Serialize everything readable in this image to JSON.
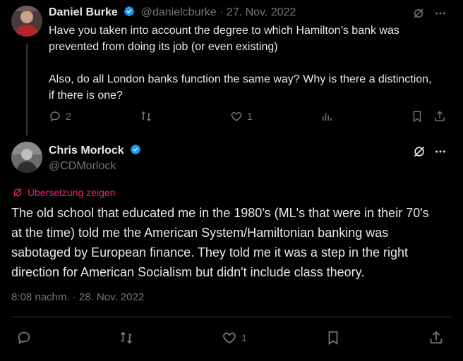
{
  "reply_tweet": {
    "author_name": "Daniel Burke",
    "author_handle": "@danielcburke",
    "date_sep": "·",
    "date": "27. Nov. 2022",
    "text_line1": "Have you taken into account the degree to which Hamilton’s bank was",
    "text_line2": "prevented from doing its job (or even existing)",
    "text_line3": "Also, do all London banks function the same way? Why is there a distinction,",
    "text_line4": "if there is one?",
    "reply_count": "2",
    "retweet_count": "",
    "like_count": "1"
  },
  "main_tweet": {
    "author_name": "Chris Morlock",
    "author_handle": "@CDMorlock",
    "translate_label": "Übersetzung zeigen",
    "text_line1": "The old school that educated me in the 1980's (ML's that were in their 70's",
    "text_line2": "at the time) told me the American System/Hamiltonian banking was",
    "text_line3": "sabotaged by European finance.  They told me it was a step in the right",
    "text_line4": "direction for American Socialism but didn't include class theory.",
    "time": "8:08 nachm.",
    "time_sep": "·",
    "date": "28. Nov. 2022",
    "like_count": "1"
  },
  "colors": {
    "accent": "#1d9bf0",
    "translate": "#f91880",
    "muted": "#71767b"
  }
}
